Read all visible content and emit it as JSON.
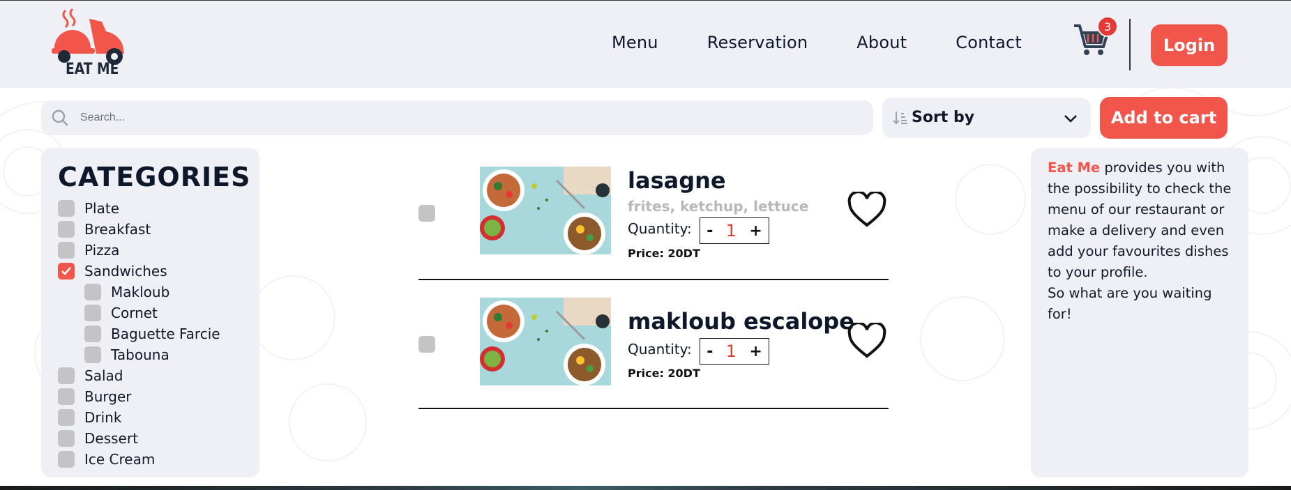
{
  "brand": {
    "name": "EAT ME",
    "accent": "#f2554a",
    "logo_icon": "delivery-scooter-icon"
  },
  "nav": {
    "items": [
      {
        "label": "Menu"
      },
      {
        "label": "Reservation"
      },
      {
        "label": "About"
      },
      {
        "label": "Contact"
      }
    ],
    "cart_count": "3",
    "login_label": "Login"
  },
  "toolbar": {
    "search_placeholder": "Search...",
    "sort_label": "Sort by",
    "add_to_cart_label": "Add to cart"
  },
  "categories": {
    "title": "CATEGORIES",
    "items": [
      {
        "label": "Plate",
        "checked": false
      },
      {
        "label": "Breakfast",
        "checked": false
      },
      {
        "label": "Pizza",
        "checked": false
      },
      {
        "label": "Sandwiches",
        "checked": true
      },
      {
        "label": "Makloub",
        "checked": false
      },
      {
        "label": "Cornet",
        "checked": false
      },
      {
        "label": "Baguette Farcie",
        "checked": false
      },
      {
        "label": "Tabouna",
        "checked": false
      },
      {
        "label": "Salad",
        "checked": false
      },
      {
        "label": "Burger",
        "checked": false
      },
      {
        "label": "Drink",
        "checked": false
      },
      {
        "label": "Dessert",
        "checked": false
      },
      {
        "label": "Ice Cream",
        "checked": false
      }
    ]
  },
  "products": [
    {
      "name": "lasagne",
      "description": "frites, ketchup, lettuce",
      "quantity_label": "Quantity:",
      "minus": "-",
      "quantity": "1",
      "plus": "+",
      "price": "Price: 20DT"
    },
    {
      "name": "makloub escalope",
      "description": "",
      "quantity_label": "Quantity:",
      "minus": "-",
      "quantity": "1",
      "plus": "+",
      "price": "Price: 20DT"
    }
  ],
  "info": {
    "brand": "Eat Me",
    "text": " provides you with the possibility to check the menu of our restaurant or make a delivery and even add your favourites dishes to your profile.",
    "text2": "So what are you waiting for!"
  }
}
